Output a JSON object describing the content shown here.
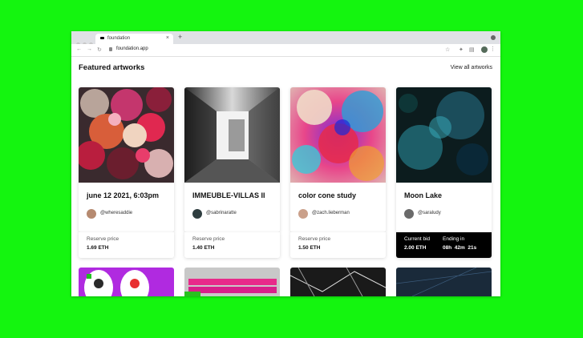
{
  "browser": {
    "tab_title": "foundation",
    "url": "foundation.app"
  },
  "page": {
    "title": "Featured artworks",
    "view_all": "View all artworks"
  },
  "cards": [
    {
      "title": "june 12 2021, 6:03pm",
      "handle": "@wheresaddie",
      "label": "Reserve price",
      "value": "1.69 ETH"
    },
    {
      "title": "IMMEUBLE-VILLAS II",
      "handle": "@sabrinaratte",
      "label": "Reserve price",
      "value": "1.40 ETH"
    },
    {
      "title": "color cone study",
      "handle": "@zach.lieberman",
      "label": "Reserve price",
      "value": "1.50 ETH"
    },
    {
      "title": "Moon Lake",
      "handle": "@saraludy",
      "bid_label": "Current bid",
      "bid_value": "2.00 ETH",
      "end_label": "Ending in",
      "end_value": "08h  42m  21s"
    }
  ]
}
